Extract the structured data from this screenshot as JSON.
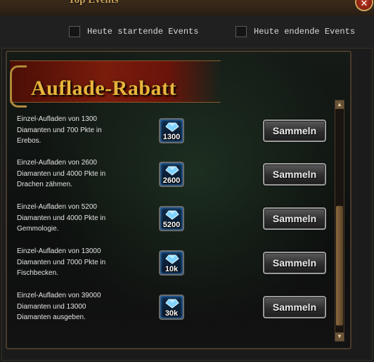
{
  "window": {
    "title": "Top Events",
    "close_icon": "close-icon"
  },
  "filters": {
    "starting_label": "Heute startende Events",
    "ending_label": "Heute endende Events"
  },
  "section": {
    "title": "Auflade-Rabatt"
  },
  "rows": [
    {
      "description": "Einzel-Aufladen von 1300\nDiamanten und 700 Pkte in\nErebos.",
      "gem_amount": "1300",
      "button": "Sammeln"
    },
    {
      "description": "Einzel-Aufladen von 2600\nDiamanten und 4000 Pkte in\nDrachen zähmen.",
      "gem_amount": "2600",
      "button": "Sammeln"
    },
    {
      "description": "Einzel-Aufladen von 5200\nDiamanten und 4000 Pkte in\nGemmologie.",
      "gem_amount": "5200",
      "button": "Sammeln"
    },
    {
      "description": "Einzel-Aufladen von 13000\nDiamanten und 7000 Pkte in\nFischbecken.",
      "gem_amount": "10k",
      "button": "Sammeln"
    },
    {
      "description": "Einzel-Aufladen von 39000\nDiamanten und 13000\nDiamanten ausgeben.",
      "gem_amount": "30k",
      "button": "Sammeln"
    }
  ],
  "colors": {
    "accent_gold": "#e8b43c",
    "banner_red": "#7a1c0c",
    "gem_blue": "#3fa0ff"
  }
}
